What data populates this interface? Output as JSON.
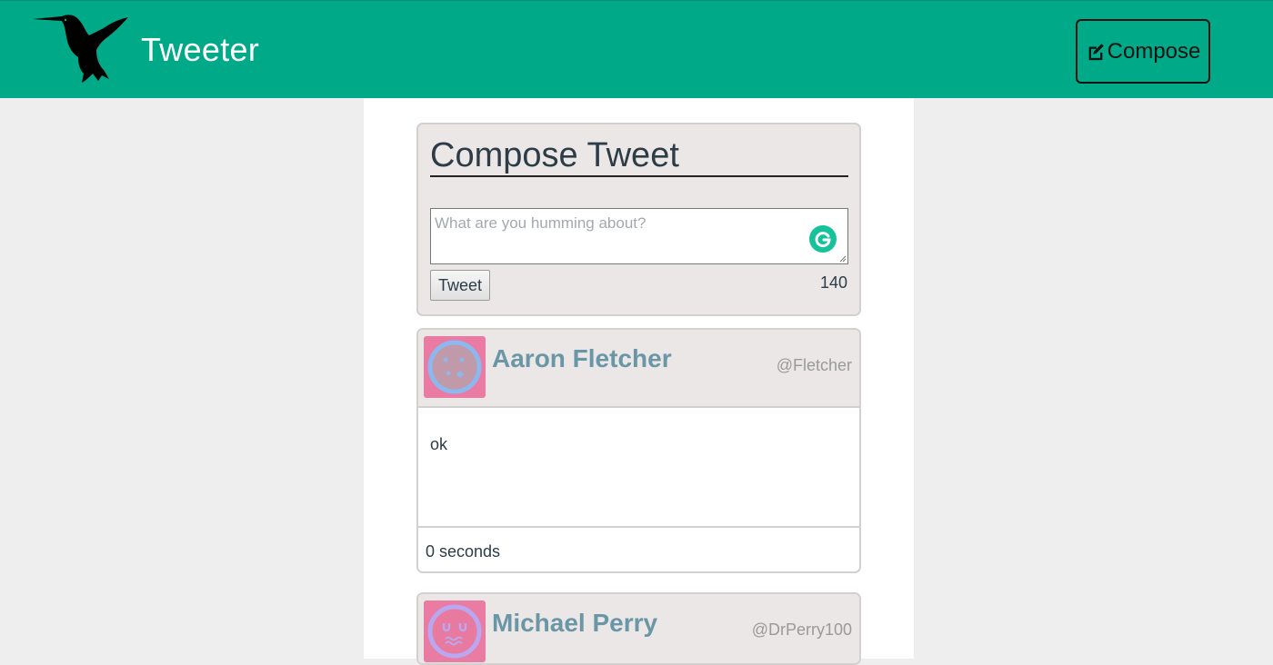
{
  "navbar": {
    "brand": "Tweeter",
    "compose_label": "Compose",
    "bg_color": "#00a987"
  },
  "compose": {
    "title": "Compose Tweet",
    "placeholder": "What are you humming about?",
    "tweet_button": "Tweet",
    "counter": "140"
  },
  "tweets": [
    {
      "name": "Aaron Fletcher",
      "handle": "@Fletcher",
      "text": "ok",
      "time": "0 seconds",
      "avatar_colors": [
        "#ea7ba3",
        "#8cb8f0"
      ]
    },
    {
      "name": "Michael Perry",
      "handle": "@DrPerry100",
      "avatar_colors": [
        "#ea7ba3",
        "#b9a7f0"
      ]
    }
  ]
}
